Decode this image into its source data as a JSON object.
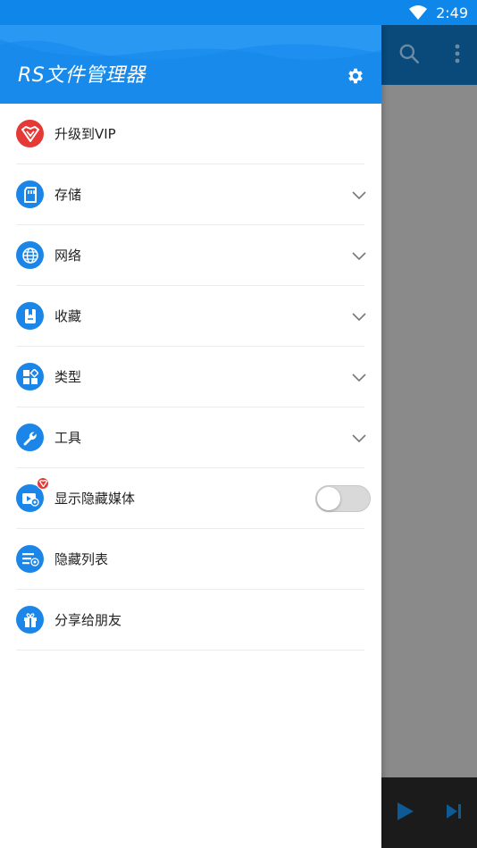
{
  "status_bar": {
    "time": "2:49",
    "wifi_icon": "wifi-icon"
  },
  "drawer": {
    "title": "RS文件管理器",
    "settings_icon": "gear-icon",
    "header_color": "#1d8ff0",
    "accent_color": "#1b86e8",
    "items": [
      {
        "label": "升级到VIP",
        "icon": "vip-crown-icon",
        "expandable": false
      },
      {
        "label": "存储",
        "icon": "sd-card-icon",
        "expandable": true
      },
      {
        "label": "网络",
        "icon": "globe-icon",
        "expandable": true
      },
      {
        "label": "收藏",
        "icon": "bookmark-icon",
        "expandable": true
      },
      {
        "label": "类型",
        "icon": "categories-icon",
        "expandable": true
      },
      {
        "label": "工具",
        "icon": "wrench-icon",
        "expandable": true
      },
      {
        "label": "显示隐藏媒体",
        "icon": "hidden-media-icon",
        "toggle": false,
        "vip_badge": true
      },
      {
        "label": "隐藏列表",
        "icon": "hidden-list-icon",
        "expandable": false
      },
      {
        "label": "分享给朋友",
        "icon": "gift-icon",
        "expandable": false
      }
    ]
  },
  "background_app": {
    "toolbar_icons": [
      "search-icon",
      "more-vert-icon"
    ],
    "player_icons": [
      "play-icon",
      "skip-next-icon"
    ]
  }
}
